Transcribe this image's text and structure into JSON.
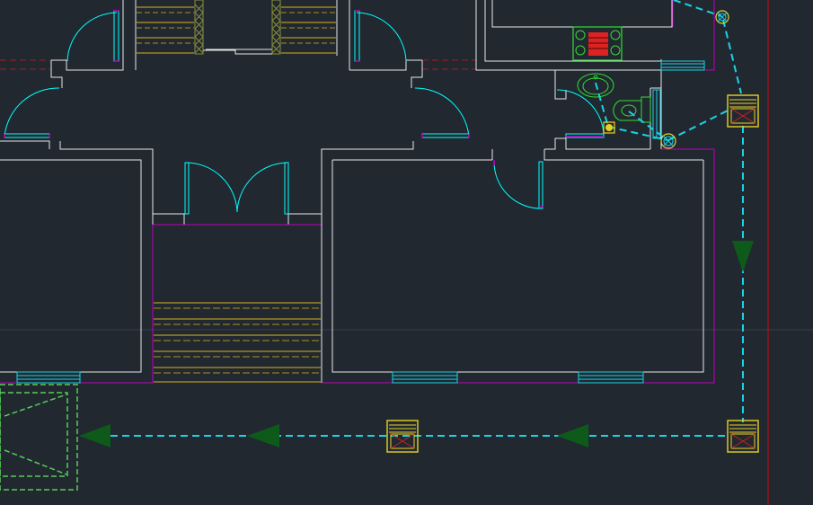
{
  "app": {
    "type": "CAD floor plan viewport"
  },
  "colors": {
    "background": "#212830",
    "wall": "#e8e8e8",
    "wall_outline": "#c000c0",
    "door": "#00ffff",
    "stair_tread": "#d6b21e",
    "hatch": "#8a8f3a",
    "drainage_line": "#19d3e6",
    "fixture": "#33dd33",
    "manhole": "#e6d227",
    "manhole_x": "#d02020",
    "flow_arrow": "#0d5a1a",
    "crosshair": "#3a414a",
    "grid_boundary": "#b01010",
    "dashed_red": "#aa1e1e",
    "septic_tank": "#55cc55",
    "stove_red": "#dd2222"
  },
  "symbols": {
    "manholes": [
      "manhole-icon",
      "manhole-icon",
      "manhole-icon",
      "manhole-icon"
    ],
    "flow_arrows": [
      "arrow-down-icon",
      "arrow-left-icon",
      "arrow-left-icon",
      "arrow-left-icon"
    ],
    "floor_traps": [
      "floor-trap-icon",
      "floor-trap-icon",
      "floor-trap-icon"
    ],
    "fixtures": [
      "wash-basin-icon",
      "toilet-icon",
      "stove-icon"
    ],
    "doors": [
      "door-swing-icon"
    ],
    "stairs": [
      "stair-icon"
    ],
    "septic": [
      "septic-tank-icon"
    ]
  }
}
